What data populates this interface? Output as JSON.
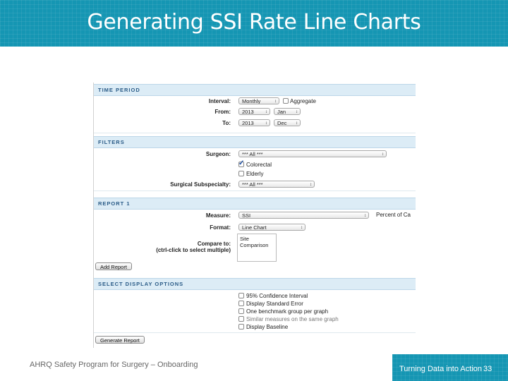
{
  "slide": {
    "title": "Generating SSI Rate Line Charts",
    "footer_left": "AHRQ Safety Program for Surgery – Onboarding",
    "footer_right": "Turning Data into Action",
    "page_number": "33",
    "accent_color": "#1596b3"
  },
  "time_period": {
    "heading": "TIME PERIOD",
    "interval_label": "Interval:",
    "interval_value": "Monthly",
    "aggregate_label": "Aggregate",
    "from_label": "From:",
    "from_year": "2013",
    "from_month": "Jan",
    "to_label": "To:",
    "to_year": "2013",
    "to_month": "Dec"
  },
  "filters": {
    "heading": "FILTERS",
    "surgeon_label": "Surgeon:",
    "surgeon_value": "*** All ***",
    "colorectal_label": "Colorectal",
    "elderly_label": "Elderly",
    "subspecialty_label": "Surgical Subspecialty:",
    "subspecialty_value": "*** All ***"
  },
  "report1": {
    "heading": "REPORT 1",
    "measure_label": "Measure:",
    "measure_value": "SSI",
    "percent_note": "Percent of Ca",
    "format_label": "Format:",
    "format_value": "Line Chart",
    "compare_label": "Compare to:",
    "compare_hint": "(ctrl-click to select multiple)",
    "compare_options": [
      "Site",
      "Comparison"
    ],
    "add_report_label": "Add Report"
  },
  "display_options": {
    "heading": "SELECT DISPLAY OPTIONS",
    "options": [
      "95% Confidence Interval",
      "Display Standard Error",
      "One benchmark group per graph",
      "Similar measures on the same graph",
      "Display Baseline"
    ],
    "generate_label": "Generate Report"
  },
  "icons": {
    "dropdown_arrow": "↕"
  }
}
